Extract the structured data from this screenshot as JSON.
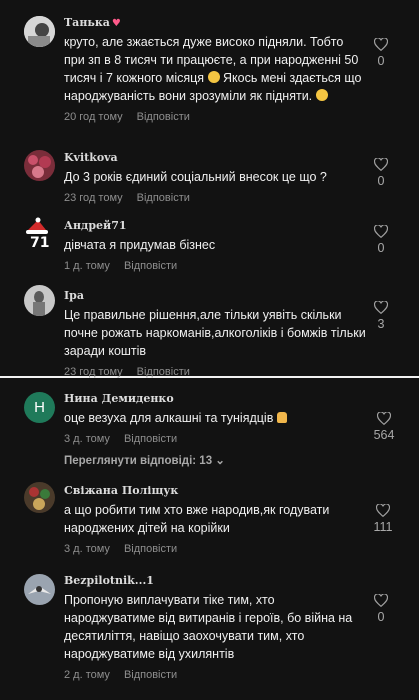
{
  "comments": [
    {
      "author": "Танька",
      "text": "круто, але зжається дуже високо підняли. Тобто при зп в 8 тисяч ти працюєте, а при народженні 50 тисяч і 7 кожного місяця",
      "text_cont": "Якось мені здається що народжуваність вони зрозуміли як підняти.",
      "time": "20 год тому",
      "reply": "Відповісти",
      "likes": "0"
    },
    {
      "author": "Kvitkova",
      "text": "До 3 років єдиний соціальний внесок це що ?",
      "time": "23 год тому",
      "reply": "Відповісти",
      "likes": "0"
    },
    {
      "author": "Андрей71",
      "text": "дівчата я придумав бізнес",
      "time": "1 д. тому",
      "reply": "Відповісти",
      "likes": "0"
    },
    {
      "author": "Іра",
      "text": "Це правильне рішення,але тільки уявіть скільки почне рожать наркоманів,алкоголіків і бомжів тільки заради коштів",
      "time": "23 год тому",
      "reply": "Відповісти",
      "likes": "3"
    },
    {
      "author": "Нина Демиденко",
      "avatar_letter": "Н",
      "text": "оце везуха для алкашні та туніядців",
      "time": "3 д. тому",
      "reply": "Відповісти",
      "likes": "564",
      "view_replies": "Переглянути відповіді: 13"
    },
    {
      "author": "Свіжана Поліщук",
      "text": "а що робити тим хто вже народив,як годувати народжених дітей на корійки",
      "time": "3 д. тому",
      "reply": "Відповісти",
      "likes": "111"
    },
    {
      "author": "Bezpilotnik...1",
      "text": "Пропоную виплачувати тіке тим, хто народжуватиме від витиранів і героїв, бо війна на десятиліття, навіщо заохочувати тим, хто народжуватиме від ухилянтів",
      "time": "2 д. тому",
      "reply": "Відповісти",
      "likes": "0"
    }
  ],
  "colors": {
    "background": "#121212",
    "divider": "#f2f2f2",
    "nina_avatar": "#1f7a5a"
  }
}
